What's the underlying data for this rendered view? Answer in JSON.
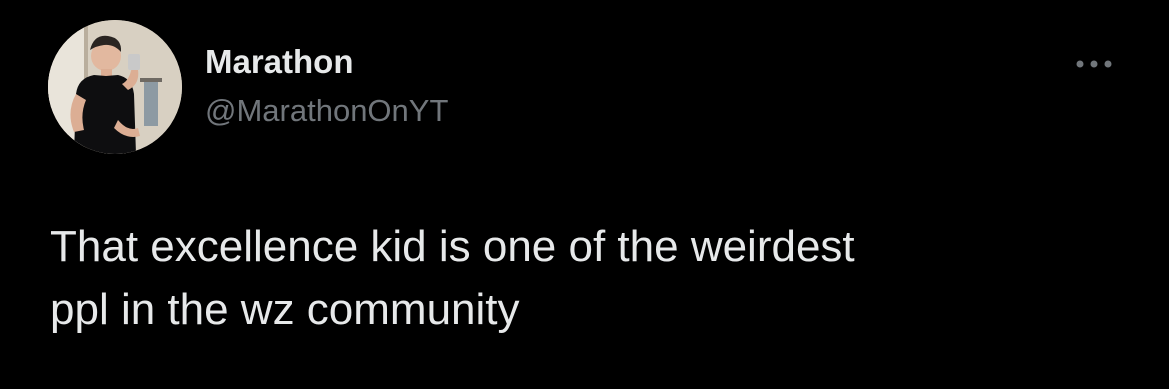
{
  "tweet": {
    "author": {
      "display_name": "Marathon",
      "handle": "@MarathonOnYT",
      "avatar_icon": "profile-photo"
    },
    "more_icon": "ellipsis-icon",
    "text": "That excellence kid is one of the weirdest\nppl in the wz community"
  },
  "colors": {
    "background": "#000000",
    "primary_text": "#e7e9ea",
    "secondary_text": "#71767b"
  }
}
